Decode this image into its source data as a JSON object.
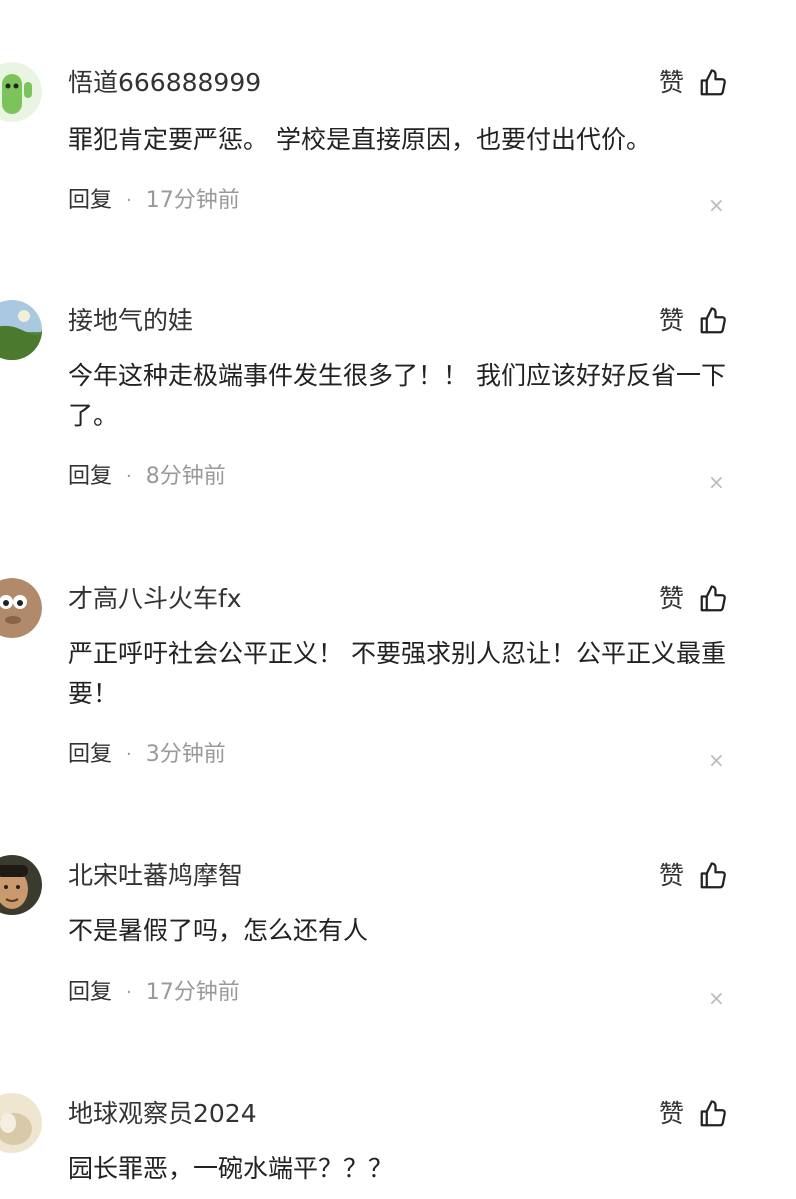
{
  "comments": [
    {
      "username": "悟道666888999",
      "text": "罪犯肯定要严惩。 学校是直接原因，也要付出代价。",
      "reply": "回复",
      "time": "17分钟前",
      "like": "赞",
      "avatar_color": "#7dc35b"
    },
    {
      "username": "接地气的娃",
      "text": "今年这种走极端事件发生很多了！！ 我们应该好好反省一下了。",
      "reply": "回复",
      "time": "8分钟前",
      "like": "赞",
      "avatar_color": "#6e9a4c"
    },
    {
      "username": "才高八斗火车fx",
      "text": "严正呼吁社会公平正义！ 不要强求别人忍让！公平正义最重要！",
      "reply": "回复",
      "time": "3分钟前",
      "like": "赞",
      "avatar_color": "#b08a6a"
    },
    {
      "username": "北宋吐蕃鸠摩智",
      "text": "不是暑假了吗，怎么还有人",
      "reply": "回复",
      "time": "17分钟前",
      "like": "赞",
      "avatar_color": "#8a6a4a"
    },
    {
      "username": "地球观察员2024",
      "text": "园长罪恶，一碗水端平？？？",
      "reply": "回复",
      "time": "",
      "like": "赞",
      "avatar_color": "#d8c9a8"
    }
  ],
  "icons": {
    "like": "thumbs-up-icon",
    "close": "close-icon"
  }
}
